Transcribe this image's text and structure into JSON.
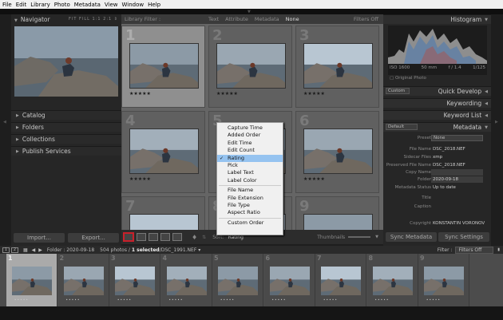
{
  "menubar": [
    "File",
    "Edit",
    "Library",
    "Photo",
    "Metadata",
    "View",
    "Window",
    "Help"
  ],
  "navigator": {
    "title": "Navigator",
    "zoom": "FIT  FILL  1:1  2:1  ⇕"
  },
  "left_panels": [
    "Catalog",
    "Folders",
    "Collections",
    "Publish Services"
  ],
  "left_buttons": {
    "import": "Import...",
    "export": "Export..."
  },
  "filter_bar": {
    "title": "Library Filter :",
    "tabs": [
      "Text",
      "Attribute",
      "Metadata",
      "None"
    ],
    "active": "None",
    "filters_state": "Filters Off"
  },
  "grid": {
    "numbers": [
      "1",
      "2",
      "3",
      "4",
      "5",
      "6",
      "7",
      "8",
      "9"
    ],
    "stars": "★★★★★"
  },
  "toolbar": {
    "sort_label": "Sort:",
    "sort_value": "Rating",
    "thumbnails_label": "Thumbnails"
  },
  "sort_menu": {
    "items": [
      "Capture Time",
      "Added Order",
      "Edit Time",
      "Edit Count",
      "Rating",
      "Pick",
      "Label Text",
      "Label Color",
      "File Name",
      "File Extension",
      "File Type",
      "Aspect Ratio",
      "Custom Order"
    ],
    "selected": "Rating"
  },
  "histogram": {
    "title": "Histogram",
    "iso": "ISO 1600",
    "focal": "50 mm",
    "aperture": "f / 1.4",
    "shutter": "1/125",
    "original": "Original Photo"
  },
  "quick_develop": {
    "title": "Quick Develop",
    "preset": "Custom"
  },
  "right_panels": [
    "Keywording",
    "Keyword List"
  ],
  "metadata": {
    "title": "Metadata",
    "preset_dropdown": "Default",
    "preset_label": "Preset",
    "preset_value": "None",
    "fields": [
      {
        "label": "File Name",
        "value": "DSC_2018.NEF"
      },
      {
        "label": "Sidecar Files",
        "value": "xmp"
      },
      {
        "label": "Preserved File Name",
        "value": "DSC_2018.NEF"
      },
      {
        "label": "Copy Name",
        "value": ""
      },
      {
        "label": "Folder",
        "value": "2020-09-18"
      },
      {
        "label": "Metadata Status",
        "value": "Up to date"
      },
      {
        "label": "Title",
        "value": ""
      },
      {
        "label": "Caption",
        "value": ""
      },
      {
        "label": "Copyright",
        "value": "KONSTANTIN VORONOV"
      }
    ]
  },
  "right_buttons": {
    "sync_metadata": "Sync Metadata",
    "sync_settings": "Sync Settings"
  },
  "filmstrip_bar": {
    "page1": "1",
    "page2": "2",
    "folder": "Folder : 2020-09-18",
    "count": "504 photos /",
    "selected": "1 selected",
    "file": "/DSC_1991.NEF ▾",
    "filter_label": "Filter :",
    "filter_value": "Filters Off"
  },
  "filmstrip": {
    "numbers": [
      "1",
      "2",
      "3",
      "4",
      "5",
      "6",
      "7",
      "8",
      "9"
    ],
    "stars": "• • • • •"
  },
  "colors": {
    "accent": "#c8202a",
    "menu_highlight": "#95c3f0",
    "panel": "#262626",
    "grid_bg": "#656565"
  }
}
